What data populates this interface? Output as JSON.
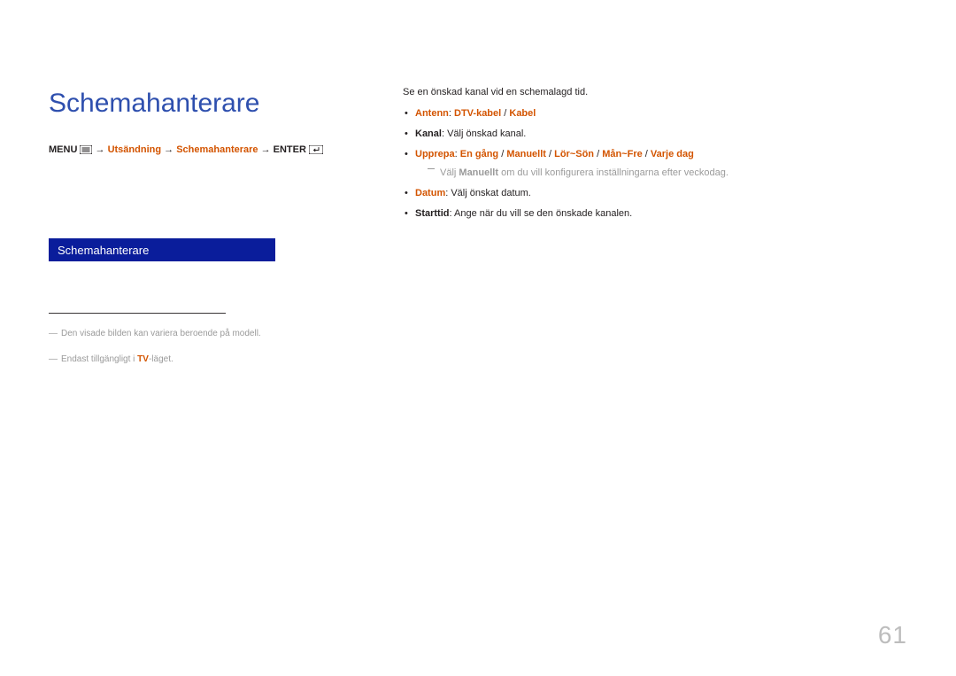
{
  "title": "Schemahanterare",
  "menupath": {
    "menu_label": "MENU",
    "arrow": " → ",
    "seg1": "Utsändning",
    "seg2": "Schemahanterare",
    "enter_label": "ENTER"
  },
  "bluebox_label": "Schemahanterare",
  "footnote1_prefix": "―",
  "footnote1": "Den visade bilden kan variera beroende på modell.",
  "footnote2_prefix": "―",
  "footnote2_a": "Endast tillgängligt i ",
  "footnote2_tv": "TV",
  "footnote2_b": "-läget.",
  "intro": "Se en önskad kanal vid en schemalagd tid.",
  "items": {
    "antenn_label": "Antenn",
    "antenn_sep": ": ",
    "antenn_opt1": "DTV-kabel",
    "antenn_slash": " / ",
    "antenn_opt2": "Kabel",
    "kanal_label": "Kanal",
    "kanal_text": ": Välj önskad kanal.",
    "upprepa_label": "Upprepa",
    "upprepa_sep": ": ",
    "upprepa_opt1": "En gång",
    "upprepa_opt2": "Manuellt",
    "upprepa_opt3": "Lör~Sön",
    "upprepa_opt4": "Mån~Fre",
    "upprepa_opt5": "Varje dag",
    "upprepa_sub_a": "Välj ",
    "upprepa_sub_b": "Manuellt",
    "upprepa_sub_c": " om du vill konfigurera inställningarna efter veckodag.",
    "datum_label": "Datum",
    "datum_text": ": Välj önskat datum.",
    "starttid_label": "Starttid",
    "starttid_text": ": Ange när du vill se den önskade kanalen."
  },
  "page_number": "61"
}
